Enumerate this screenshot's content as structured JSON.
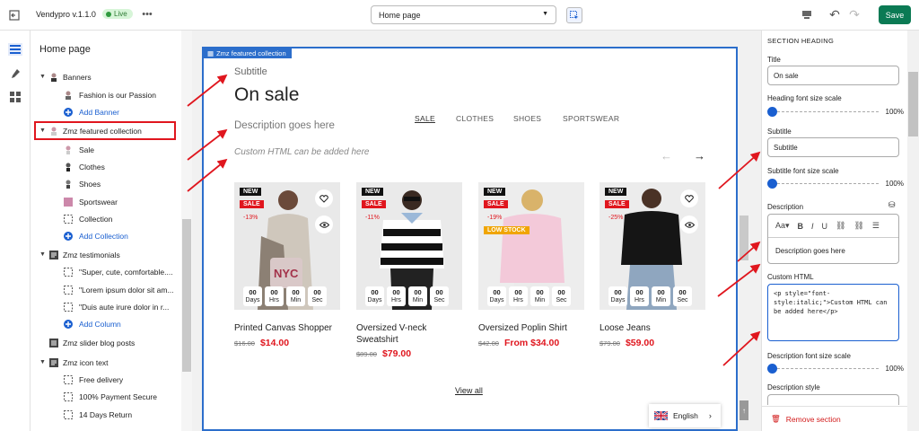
{
  "app": {
    "name": "Vendypro v.1.1.0",
    "status": "Live"
  },
  "toolbar": {
    "page_select": "Home page",
    "save_label": "Save"
  },
  "sidebar": {
    "title": "Home page",
    "rows": [
      {
        "label": "Banners",
        "kind": "section"
      },
      {
        "label": "Fashion is our Passion",
        "kind": "child"
      },
      {
        "label": "Add Banner",
        "kind": "add"
      },
      {
        "label": "Zmz featured collection",
        "kind": "section"
      },
      {
        "label": "Sale",
        "kind": "child"
      },
      {
        "label": "Clothes",
        "kind": "child"
      },
      {
        "label": "Shoes",
        "kind": "child"
      },
      {
        "label": "Sportswear",
        "kind": "child"
      },
      {
        "label": "Collection",
        "kind": "child"
      },
      {
        "label": "Add Collection",
        "kind": "add"
      },
      {
        "label": "Zmz testimonials",
        "kind": "section"
      },
      {
        "label": "\"Super, cute, comfortable....",
        "kind": "child"
      },
      {
        "label": "\"Lorem ipsum dolor sit am...",
        "kind": "child"
      },
      {
        "label": "\"Duis aute irure dolor in r...",
        "kind": "child"
      },
      {
        "label": "Add Column",
        "kind": "add"
      },
      {
        "label": "Zmz slider blog posts",
        "kind": "section-nocaret"
      },
      {
        "label": "Zmz icon text",
        "kind": "section"
      },
      {
        "label": "Free delivery",
        "kind": "child"
      },
      {
        "label": "100% Payment Secure",
        "kind": "child"
      },
      {
        "label": "14 Days Return",
        "kind": "child"
      }
    ]
  },
  "canvas": {
    "section_tag": "Zmz featured collection",
    "subtitle": "Subtitle",
    "title": "On sale",
    "description": "Description goes here",
    "custom_html": "Custom HTML can be added here",
    "tabs": [
      "SALE",
      "CLOTHES",
      "SHOES",
      "SPORTSWEAR"
    ],
    "view_all": "View all",
    "language": "English",
    "countdown_labels": {
      "days": "Days",
      "hrs": "Hrs",
      "min": "Min",
      "sec": "Sec",
      "value": "00"
    },
    "products": [
      {
        "name": "Printed Canvas Shopper",
        "old_price": "$16.00",
        "price": "$14.00",
        "badges": [
          "NEW",
          "SALE"
        ],
        "discount": "-13%",
        "low_stock": ""
      },
      {
        "name": "Oversized V-neck Sweatshirt",
        "old_price": "$89.00",
        "price": "$79.00",
        "badges": [
          "NEW",
          "SALE"
        ],
        "discount": "-11%",
        "low_stock": ""
      },
      {
        "name": "Oversized Poplin Shirt",
        "old_price": "$42.00",
        "price": "From $34.00",
        "badges": [
          "NEW",
          "SALE"
        ],
        "discount": "-19%",
        "low_stock": "LOW STOCK"
      },
      {
        "name": "Loose Jeans",
        "old_price": "$79.00",
        "price": "$59.00",
        "badges": [
          "NEW",
          "SALE"
        ],
        "discount": "-25%",
        "low_stock": ""
      }
    ]
  },
  "settings": {
    "section_heading": "SECTION HEADING",
    "title_label": "Title",
    "title_value": "On sale",
    "heading_scale_label": "Heading font size scale",
    "heading_scale_value": "100%",
    "subtitle_label": "Subtitle",
    "subtitle_value": "Subtitle",
    "subtitle_scale_label": "Subtitle font size scale",
    "subtitle_scale_value": "100%",
    "description_label": "Description",
    "description_value": "Description goes here",
    "custom_html_label": "Custom HTML",
    "custom_html_value": "<p style=\"font-style:italic;\">Custom HTML can be added here</p>",
    "desc_scale_label": "Description font size scale",
    "desc_scale_value": "100%",
    "desc_style_label": "Description style",
    "remove_section": "Remove section"
  },
  "colors": {
    "accent": "#2c6ecb",
    "save": "#0b7a54",
    "sale_red": "#e0161e",
    "annotation": "#e0161e"
  }
}
